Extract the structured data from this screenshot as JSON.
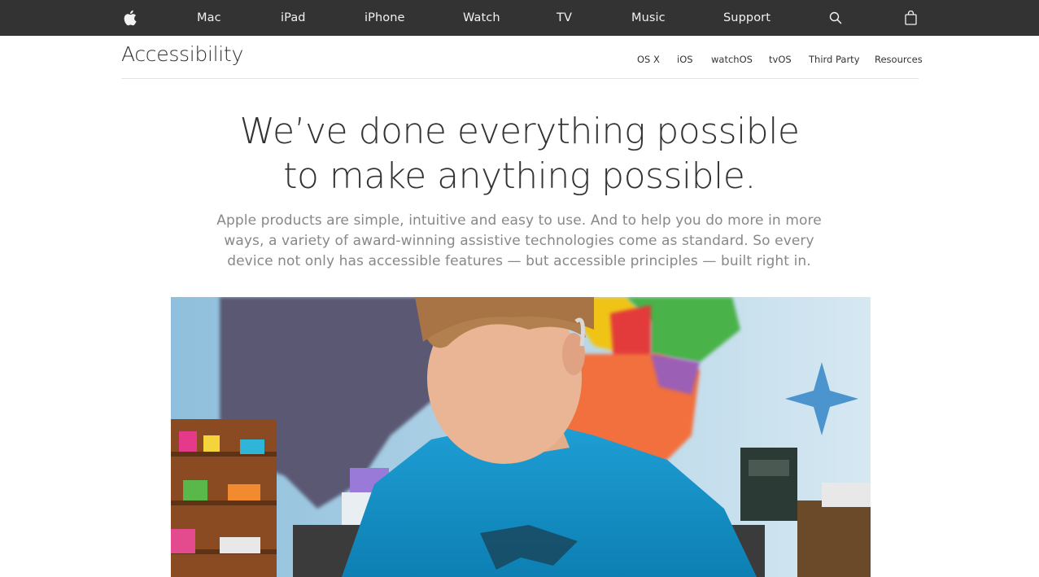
{
  "globalnav": {
    "logo": "apple-logo",
    "items": [
      {
        "label": "Mac"
      },
      {
        "label": "iPad"
      },
      {
        "label": "iPhone"
      },
      {
        "label": "Watch"
      },
      {
        "label": "TV"
      },
      {
        "label": "Music"
      },
      {
        "label": "Support"
      }
    ],
    "search_icon": "search-icon",
    "bag_icon": "bag-icon",
    "background": "#333333"
  },
  "localnav": {
    "title": "Accessibility",
    "links": [
      {
        "label": "OS X"
      },
      {
        "label": "iOS"
      },
      {
        "label": "watchOS"
      },
      {
        "label": "tvOS"
      },
      {
        "label": "Third Party"
      },
      {
        "label": "Resources"
      }
    ]
  },
  "hero": {
    "headline_line1": "We’ve done everything possible",
    "headline_line2": "to make anything possible.",
    "intro_line1": "Apple products are simple, intuitive and easy to use. And to help you do more in more",
    "intro_line2": "ways, a variety of award-winning assistive technologies come as standard. So every",
    "intro_line3": "device not only has accessible features — but accessible principles — built right in."
  },
  "colors": {
    "text": "#333333",
    "intro_text": "#888888",
    "nav_text": "#f2f2f2"
  }
}
